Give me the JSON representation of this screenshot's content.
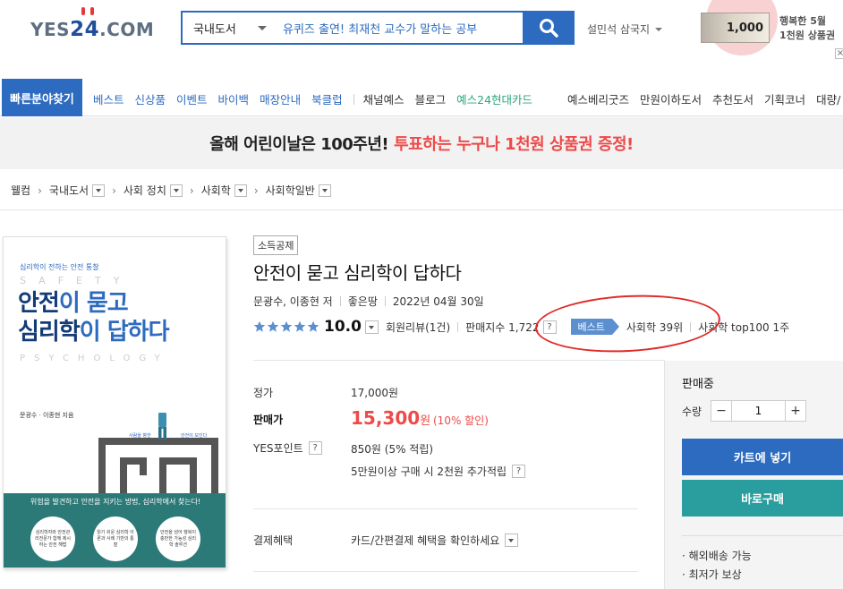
{
  "header": {
    "logo_text": "YES24.COM",
    "logo_pre": "YES",
    "logo_24": "24",
    "logo_post": ".COM",
    "search_scope": "국내도서",
    "search_value": "유퀴즈 출연! 최재천 교수가 말하는 공부",
    "header_link": "설민석 삼국지",
    "promo_ticket_value": "1,000",
    "promo_line1": "행복한 5월",
    "promo_line2": "1천원 상품권",
    "close_label": "×"
  },
  "nav": {
    "quick_category": "빠른분야찾기",
    "links_blue": [
      "베스트",
      "신상품",
      "이벤트",
      "바이백",
      "매장안내",
      "북클럽"
    ],
    "links_dark": [
      "채널예스",
      "블로그"
    ],
    "link_green": "예스24현대카드",
    "links_right": [
      "예스베리굿즈",
      "만원이하도서",
      "추천도서",
      "기획코너",
      "대량/"
    ]
  },
  "banner": {
    "part1": "올해 어린이날은 100주년!",
    "part2": "투표하는 누구나 1천원 상품권 증정!"
  },
  "breadcrumb": [
    "웰컴",
    "국내도서",
    "사회 정치",
    "사회학",
    "사회학일반"
  ],
  "cover": {
    "subtitle": "심리학이 전하는 안전 통찰",
    "safety": "SAFETY",
    "title_line1_a": "안전",
    "title_line1_b": "이 묻고",
    "title_line2_a": "심리학",
    "title_line2_b": "이 답하다",
    "psychology": "PSYCHOLOGY",
    "authors": "문광수 · 이종현 지음",
    "small1": "사람을 향한",
    "small2": "안전이 보인다",
    "bottom_line": "위험을 발견하고 안전을 지키는 방법, 심리학에서 찾는다!",
    "circles": [
      "심리학자와 안전관리전문가 함께 제시하는 안전 해법",
      "읽기 쉬운 심리학 이론과 사례 기반의 통찰",
      "안전을 넘어 행복이 충만한 가능성 심리학 솔루션"
    ]
  },
  "product": {
    "tag": "소득공제",
    "title": "안전이 묻고 심리학이 답하다",
    "authors": "문광수, 이종현 저",
    "publisher": "좋은땅",
    "date": "2022년 04월 30일",
    "score": "10.0",
    "review": "회원리뷰(1건)",
    "sales_index": "판매지수 1,722",
    "best_badge": "베스트",
    "rank1": "사회학 39위",
    "rank2": "사회학 top100 1주",
    "qmark": "?"
  },
  "price": {
    "list_label": "정가",
    "list_value": "17,000원",
    "sale_label": "판매가",
    "sale_value": "15,300",
    "sale_unit": "원",
    "sale_discount": "(10% 할인)",
    "points_label": "YES포인트",
    "points_value": "850원 (5% 적립)",
    "points_extra": "5만원이상 구매 시 2천원 추가적립",
    "payment_label": "결제혜택",
    "payment_value": "카드/간편결제 혜택을 확인하세요"
  },
  "panel": {
    "status": "판매중",
    "qty_label": "수량",
    "qty_value": "1",
    "minus": "−",
    "plus": "+",
    "cart_button": "카트에 넣기",
    "buy_button": "바로구매",
    "benefits": [
      "· 해외배송 가능",
      "· 최저가 보상"
    ]
  },
  "colors": {
    "brand_blue": "#2c6bc0",
    "teal": "#2a9d9e",
    "price_red": "#ee4a4a",
    "annotation_red": "#e02a2a"
  }
}
